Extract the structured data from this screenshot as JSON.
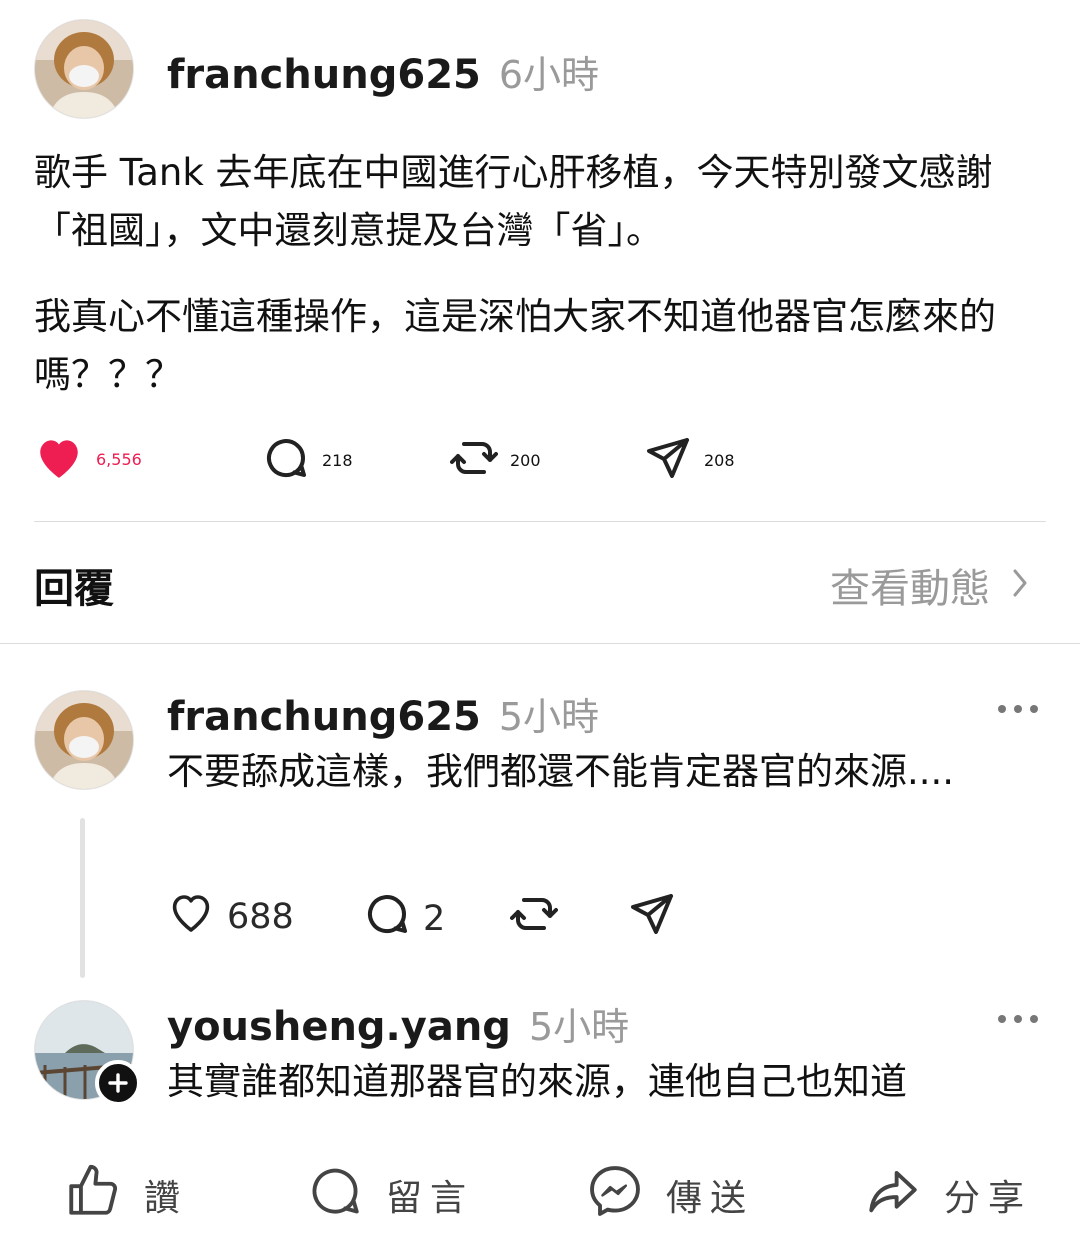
{
  "post": {
    "username": "franchung625",
    "time": "6小時",
    "paragraph1": "歌手 Tank 去年底在中國進行心肝移植，今天特別發文感謝「祖國」，文中還刻意提及台灣「省」。",
    "paragraph2": "我真心不懂這種操作，這是深怕大家不知道他器官怎麼來的嗎？？？",
    "likes": "6,556",
    "comments": "218",
    "reposts": "200",
    "shares": "208",
    "like_color": "#ee1d52"
  },
  "replies_bar": {
    "title": "回覆",
    "activity_link": "查看動態"
  },
  "replies": [
    {
      "username": "franchung625",
      "time": "5小時",
      "text": "不要舔成這樣，我們都還不能肯定器官的來源....",
      "likes": "688",
      "comments": "2"
    },
    {
      "username": "yousheng.yang",
      "time": "5小時",
      "text": "其實誰都知道那器官的來源，連他自己也知道"
    }
  ],
  "bottom_bar": {
    "like": "讚",
    "comment": "留言",
    "send": "傳送",
    "share": "分享"
  }
}
